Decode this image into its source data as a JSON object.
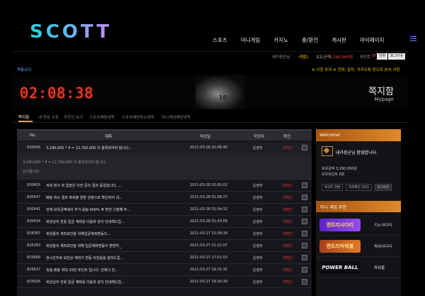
{
  "header": {
    "logo": "SCOTT",
    "nav": [
      "스포츠",
      "미니게임",
      "카지노",
      "충/환전",
      "게시판",
      "마이페이지"
    ]
  },
  "userbar": {
    "greeting": "내가장군님",
    "level": "레벨1",
    "money_label": "보유금액",
    "money": "3,190,000원",
    "point_label": "포인트",
    "point": "0P",
    "convert_button": "전환",
    "logout_button": "로그아웃"
  },
  "breadcrumb": "쪽통요지",
  "ticker": "※ 사칭 주의 ※ 전화, 문자, 카카오톡 등으로 본사 사칭",
  "banner": {
    "clock": "02:08:38",
    "title": "쪽지함",
    "subtitle": "Mypage"
  },
  "tabs": [
    "쪽지함",
    "내 정보 수정",
    "추천인 보기",
    "스포츠배팅내역",
    "스포츠배팅취소내역",
    "미니게임배팅내역"
  ],
  "table": {
    "headers": [
      "No.",
      "제목",
      "작성일",
      "작성자",
      "확인"
    ],
    "rows": [
      {
        "no": "830456",
        "title": "3,190,000 * 4 = 12,760,000 이 충족되어야 합니다...",
        "date": "2021-03-28 02:06:40",
        "author": "운영자",
        "check": "미확인"
      },
      {
        "no": "830455",
        "title": "저희 본사 측 입장은 이전 문의 결과 동일합니다. ...",
        "date": "2021-03-28 02:05:02",
        "author": "운영자",
        "check": "미확인"
      },
      {
        "no": "830447",
        "title": "배팅 취소 결과 파워볼 양방 성향으로 확인되어 내...",
        "date": "2021-03-28 01:58:27",
        "author": "운영자",
        "check": "미확인"
      },
      {
        "no": "830441",
        "title": "현재 보유금액에서 추가 롤링 400% 후 환전 신청해 주...",
        "date": "2021-03-28 01:54:32",
        "author": "운영자",
        "check": "미확인"
      },
      {
        "no": "830434",
        "title": "회원님의 전용 입금 계좌를 다음과 같이 안내해드립...",
        "date": "2021-03-28 01:43:09",
        "author": "운영자",
        "check": "미확인"
      },
      {
        "no": "828387",
        "title": "회원들의 계좌보안을 위해입금계좌변동이...",
        "date": "2021-03-27 21:58:39",
        "author": "운영자",
        "check": "미확인"
      },
      {
        "no": "826383",
        "title": "회원들의 계좌보안을 위해 입금계좌변동이 변변허 _",
        "date": "2021-03-27 21:22:07",
        "author": "운영자",
        "check": "미확인"
      },
      {
        "no": "825660",
        "title": "현시간부로 보안상 계좌가 변동 되었음을 알려드립...",
        "date": "2021-03-27 17:51:03",
        "author": "운영자",
        "check": "미확인"
      },
      {
        "no": "825627",
        "title": "첫충,매충 최대 20만 포인트 입니다. 언제나 만...",
        "date": "2021-03-27 16:31:35",
        "author": "운영자",
        "check": "미확인"
      },
      {
        "no": "825626",
        "title": "회원님의 전용 입금 계좌를 다음과 같이 안내해드립...",
        "date": "2021-03-27 16:30:39",
        "author": "운영자",
        "check": "미확인"
      }
    ],
    "expanded": {
      "line1": "3,190,000 * 4 = 12,760,000 이 충족되어야 합니다.",
      "line2": "감사합니다."
    }
  },
  "panel": {
    "welcome": "Welcome!",
    "name": "내가장군님 환영합니다.",
    "money": "보유금액 3,190,000원",
    "point": "보유포인트 0원",
    "buttons": [
      "포인트 전환",
      "쪽지확인 [0건]",
      "로그아웃"
    ],
    "mini_header": "미니 게임 추천",
    "games": [
      {
        "logo": "엔트리사다리",
        "name": "키노사다리",
        "color": "#7a3cf0"
      },
      {
        "logo": "엔트리파워볼",
        "name": "파워사다리",
        "color": "#c9581a"
      },
      {
        "logo": "POWER BALL",
        "name": "파워볼",
        "color": "#2266cc"
      }
    ]
  }
}
